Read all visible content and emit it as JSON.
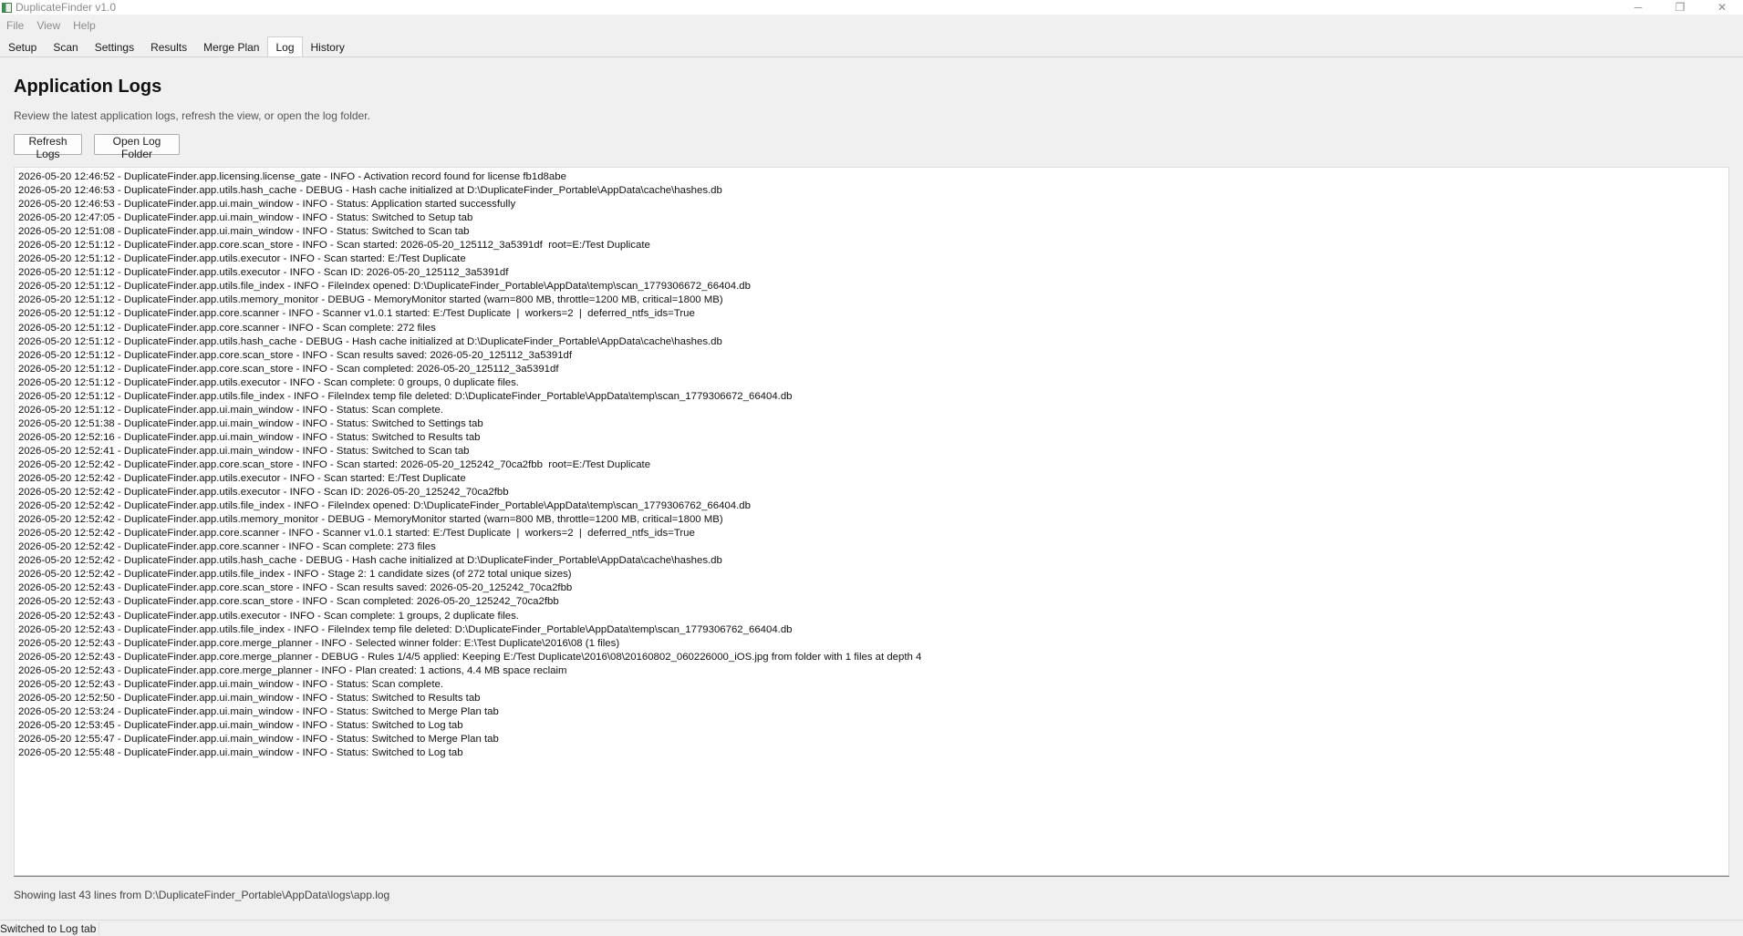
{
  "window": {
    "title": "DuplicateFinder v1.0",
    "minimize_glyph": "─",
    "maximize_glyph": "❐",
    "close_glyph": "✕"
  },
  "menu": [
    "File",
    "View",
    "Help"
  ],
  "tabs": [
    "Setup",
    "Scan",
    "Settings",
    "Results",
    "Merge Plan",
    "Log",
    "History"
  ],
  "active_tab": "Log",
  "page": {
    "title": "Application Logs",
    "description": "Review the latest application logs, refresh the view, or open the log folder.",
    "refresh_button": "Refresh Logs",
    "open_folder_button": "Open Log Folder"
  },
  "log_lines": [
    "2026-05-20 12:46:52 - DuplicateFinder.app.licensing.license_gate - INFO - Activation record found for license fb1d8abe",
    "2026-05-20 12:46:53 - DuplicateFinder.app.utils.hash_cache - DEBUG - Hash cache initialized at D:\\DuplicateFinder_Portable\\AppData\\cache\\hashes.db",
    "2026-05-20 12:46:53 - DuplicateFinder.app.ui.main_window - INFO - Status: Application started successfully",
    "2026-05-20 12:47:05 - DuplicateFinder.app.ui.main_window - INFO - Status: Switched to Setup tab",
    "2026-05-20 12:51:08 - DuplicateFinder.app.ui.main_window - INFO - Status: Switched to Scan tab",
    "2026-05-20 12:51:12 - DuplicateFinder.app.core.scan_store - INFO - Scan started: 2026-05-20_125112_3a5391df  root=E:/Test Duplicate",
    "2026-05-20 12:51:12 - DuplicateFinder.app.utils.executor - INFO - Scan started: E:/Test Duplicate",
    "2026-05-20 12:51:12 - DuplicateFinder.app.utils.executor - INFO - Scan ID: 2026-05-20_125112_3a5391df",
    "2026-05-20 12:51:12 - DuplicateFinder.app.utils.file_index - INFO - FileIndex opened: D:\\DuplicateFinder_Portable\\AppData\\temp\\scan_1779306672_66404.db",
    "2026-05-20 12:51:12 - DuplicateFinder.app.utils.memory_monitor - DEBUG - MemoryMonitor started (warn=800 MB, throttle=1200 MB, critical=1800 MB)",
    "2026-05-20 12:51:12 - DuplicateFinder.app.core.scanner - INFO - Scanner v1.0.1 started: E:/Test Duplicate  |  workers=2  |  deferred_ntfs_ids=True",
    "2026-05-20 12:51:12 - DuplicateFinder.app.core.scanner - INFO - Scan complete: 272 files",
    "2026-05-20 12:51:12 - DuplicateFinder.app.utils.hash_cache - DEBUG - Hash cache initialized at D:\\DuplicateFinder_Portable\\AppData\\cache\\hashes.db",
    "2026-05-20 12:51:12 - DuplicateFinder.app.core.scan_store - INFO - Scan results saved: 2026-05-20_125112_3a5391df",
    "2026-05-20 12:51:12 - DuplicateFinder.app.core.scan_store - INFO - Scan completed: 2026-05-20_125112_3a5391df",
    "2026-05-20 12:51:12 - DuplicateFinder.app.utils.executor - INFO - Scan complete: 0 groups, 0 duplicate files.",
    "2026-05-20 12:51:12 - DuplicateFinder.app.utils.file_index - INFO - FileIndex temp file deleted: D:\\DuplicateFinder_Portable\\AppData\\temp\\scan_1779306672_66404.db",
    "2026-05-20 12:51:12 - DuplicateFinder.app.ui.main_window - INFO - Status: Scan complete.",
    "2026-05-20 12:51:38 - DuplicateFinder.app.ui.main_window - INFO - Status: Switched to Settings tab",
    "2026-05-20 12:52:16 - DuplicateFinder.app.ui.main_window - INFO - Status: Switched to Results tab",
    "2026-05-20 12:52:41 - DuplicateFinder.app.ui.main_window - INFO - Status: Switched to Scan tab",
    "2026-05-20 12:52:42 - DuplicateFinder.app.core.scan_store - INFO - Scan started: 2026-05-20_125242_70ca2fbb  root=E:/Test Duplicate",
    "2026-05-20 12:52:42 - DuplicateFinder.app.utils.executor - INFO - Scan started: E:/Test Duplicate",
    "2026-05-20 12:52:42 - DuplicateFinder.app.utils.executor - INFO - Scan ID: 2026-05-20_125242_70ca2fbb",
    "2026-05-20 12:52:42 - DuplicateFinder.app.utils.file_index - INFO - FileIndex opened: D:\\DuplicateFinder_Portable\\AppData\\temp\\scan_1779306762_66404.db",
    "2026-05-20 12:52:42 - DuplicateFinder.app.utils.memory_monitor - DEBUG - MemoryMonitor started (warn=800 MB, throttle=1200 MB, critical=1800 MB)",
    "2026-05-20 12:52:42 - DuplicateFinder.app.core.scanner - INFO - Scanner v1.0.1 started: E:/Test Duplicate  |  workers=2  |  deferred_ntfs_ids=True",
    "2026-05-20 12:52:42 - DuplicateFinder.app.core.scanner - INFO - Scan complete: 273 files",
    "2026-05-20 12:52:42 - DuplicateFinder.app.utils.hash_cache - DEBUG - Hash cache initialized at D:\\DuplicateFinder_Portable\\AppData\\cache\\hashes.db",
    "2026-05-20 12:52:42 - DuplicateFinder.app.utils.file_index - INFO - Stage 2: 1 candidate sizes (of 272 total unique sizes)",
    "2026-05-20 12:52:43 - DuplicateFinder.app.core.scan_store - INFO - Scan results saved: 2026-05-20_125242_70ca2fbb",
    "2026-05-20 12:52:43 - DuplicateFinder.app.core.scan_store - INFO - Scan completed: 2026-05-20_125242_70ca2fbb",
    "2026-05-20 12:52:43 - DuplicateFinder.app.utils.executor - INFO - Scan complete: 1 groups, 2 duplicate files.",
    "2026-05-20 12:52:43 - DuplicateFinder.app.utils.file_index - INFO - FileIndex temp file deleted: D:\\DuplicateFinder_Portable\\AppData\\temp\\scan_1779306762_66404.db",
    "2026-05-20 12:52:43 - DuplicateFinder.app.core.merge_planner - INFO - Selected winner folder: E:\\Test Duplicate\\2016\\08 (1 files)",
    "2026-05-20 12:52:43 - DuplicateFinder.app.core.merge_planner - DEBUG - Rules 1/4/5 applied: Keeping E:/Test Duplicate\\2016\\08\\20160802_060226000_iOS.jpg from folder with 1 files at depth 4",
    "2026-05-20 12:52:43 - DuplicateFinder.app.core.merge_planner - INFO - Plan created: 1 actions, 4.4 MB space reclaim",
    "2026-05-20 12:52:43 - DuplicateFinder.app.ui.main_window - INFO - Status: Scan complete.",
    "2026-05-20 12:52:50 - DuplicateFinder.app.ui.main_window - INFO - Status: Switched to Results tab",
    "2026-05-20 12:53:24 - DuplicateFinder.app.ui.main_window - INFO - Status: Switched to Merge Plan tab",
    "2026-05-20 12:53:45 - DuplicateFinder.app.ui.main_window - INFO - Status: Switched to Log tab",
    "2026-05-20 12:55:47 - DuplicateFinder.app.ui.main_window - INFO - Status: Switched to Merge Plan tab",
    "2026-05-20 12:55:48 - DuplicateFinder.app.ui.main_window - INFO - Status: Switched to Log tab"
  ],
  "footer": "Showing last 43 lines from D:\\DuplicateFinder_Portable\\AppData\\logs\\app.log",
  "status_bar": "Switched to Log tab"
}
